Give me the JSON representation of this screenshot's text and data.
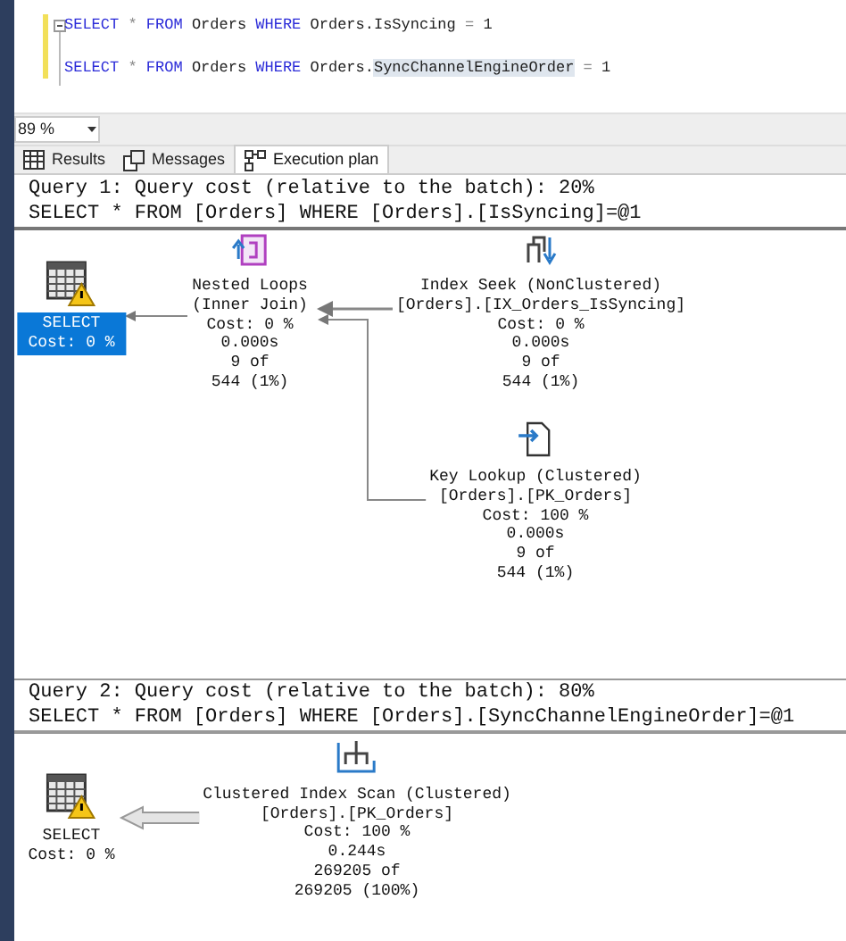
{
  "editor": {
    "lines": [
      {
        "tokens": [
          {
            "kind": "keyword",
            "text": "SELECT "
          },
          {
            "kind": "operator",
            "text": "* "
          },
          {
            "kind": "keyword",
            "text": "FROM "
          },
          {
            "kind": "plain",
            "text": "Orders "
          },
          {
            "kind": "keyword",
            "text": "WHERE "
          },
          {
            "kind": "plain",
            "text": "Orders.IsSyncing "
          },
          {
            "kind": "operator",
            "text": "= "
          },
          {
            "kind": "plain",
            "text": "1"
          }
        ]
      },
      {
        "tokens": [
          {
            "kind": "keyword",
            "text": "SELECT "
          },
          {
            "kind": "operator",
            "text": "* "
          },
          {
            "kind": "keyword",
            "text": "FROM "
          },
          {
            "kind": "plain",
            "text": "Orders "
          },
          {
            "kind": "keyword",
            "text": "WHERE "
          },
          {
            "kind": "plain",
            "text": "Orders."
          },
          {
            "kind": "highlight",
            "text": "SyncChannelEngineOrder"
          },
          {
            "kind": "operator",
            "text": " = "
          },
          {
            "kind": "plain",
            "text": "1"
          }
        ]
      }
    ]
  },
  "zoom": {
    "value": "89 %"
  },
  "tabs": [
    {
      "label": "Results",
      "kind": "grid",
      "selected": false
    },
    {
      "label": "Messages",
      "kind": "messages",
      "selected": false
    },
    {
      "label": "Execution plan",
      "kind": "plan",
      "selected": true
    }
  ],
  "queries": [
    {
      "header": "Query 1: Query cost (relative to the batch): 20%",
      "statement": "SELECT * FROM [Orders] WHERE [Orders].[IsSyncing]=@1",
      "nodes": [
        {
          "kind": "select",
          "selected": true,
          "lines": [
            "SELECT",
            "Cost: 0 %"
          ]
        },
        {
          "kind": "nested_loops",
          "selected": false,
          "lines": [
            "Nested Loops",
            "(Inner Join)",
            "Cost: 0 %",
            "0.000s",
            "9 of",
            "544 (1%)"
          ]
        },
        {
          "kind": "index_seek",
          "selected": false,
          "lines": [
            "Index Seek (NonClustered)",
            "[Orders].[IX_Orders_IsSyncing]",
            "Cost: 0 %",
            "0.000s",
            "9 of",
            "544 (1%)"
          ]
        },
        {
          "kind": "key_lookup",
          "selected": false,
          "lines": [
            "Key Lookup (Clustered)",
            "[Orders].[PK_Orders]",
            "Cost: 100 %",
            "0.000s",
            "9 of",
            "544 (1%)"
          ]
        }
      ]
    },
    {
      "header": "Query 2: Query cost (relative to the batch): 80%",
      "statement": "SELECT * FROM [Orders] WHERE [Orders].[SyncChannelEngineOrder]=@1",
      "nodes": [
        {
          "kind": "select",
          "selected": false,
          "lines": [
            "SELECT",
            "Cost: 0 %"
          ]
        },
        {
          "kind": "clustered_index_scan",
          "selected": false,
          "lines": [
            "Clustered Index Scan (Clustered)",
            "[Orders].[PK_Orders]",
            "Cost: 100 %",
            "0.244s",
            "269205 of",
            "269205 (100%)"
          ]
        }
      ]
    }
  ]
}
